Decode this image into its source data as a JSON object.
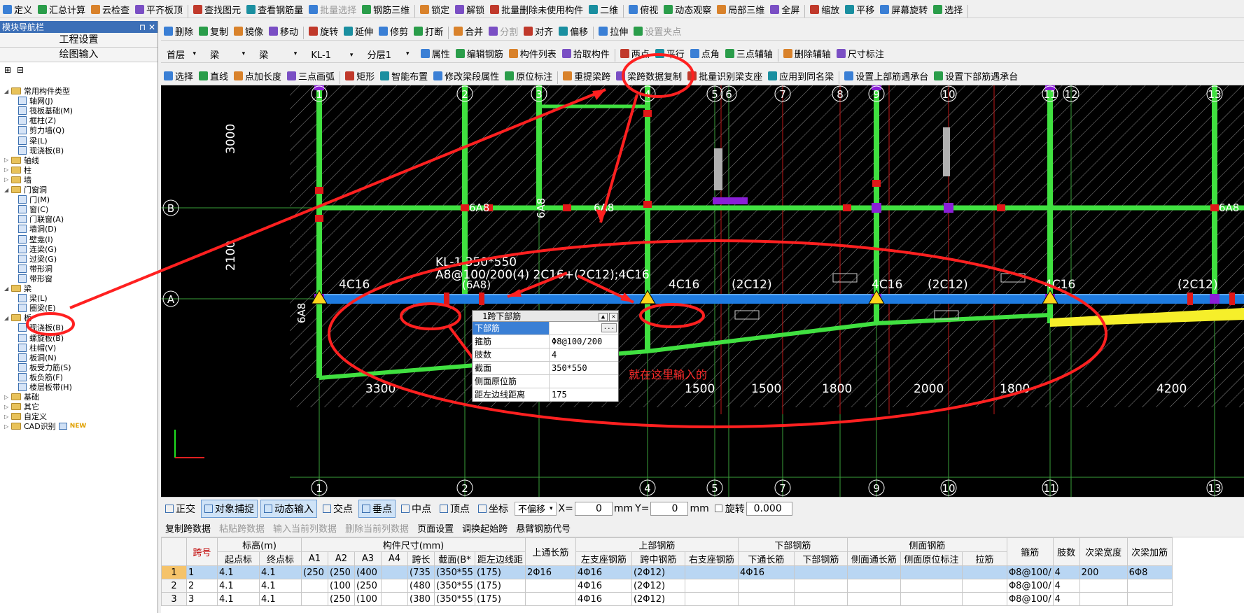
{
  "toolbar1": {
    "items": [
      "定义",
      "汇总计算",
      "云检查",
      "平齐板顶",
      "查找图元",
      "查看钢筋量",
      "批量选择",
      "钢筋三维",
      "锁定",
      "解锁",
      "批量删除未使用构件",
      "二维",
      "俯视",
      "动态观察",
      "局部三维",
      "全屏",
      "缩放",
      "平移",
      "屏幕旋转",
      "选择"
    ]
  },
  "toolbar2": {
    "items": [
      "删除",
      "复制",
      "镜像",
      "移动",
      "旋转",
      "延伸",
      "修剪",
      "打断",
      "合并",
      "分割",
      "对齐",
      "偏移",
      "拉伸",
      "设置夹点"
    ]
  },
  "toolbar3": {
    "floor": "首层",
    "type1": "梁",
    "type2": "梁",
    "element": "KL-1",
    "layer": "分层1",
    "items": [
      "属性",
      "编辑钢筋",
      "构件列表",
      "拾取构件",
      "两点",
      "平行",
      "点角",
      "三点辅轴",
      "删除辅轴",
      "尺寸标注"
    ]
  },
  "toolbar4": {
    "items": [
      "选择",
      "直线",
      "点加长度",
      "三点画弧",
      "矩形",
      "智能布置",
      "修改梁段属性",
      "原位标注",
      "重提梁跨",
      "梁跨数据复制",
      "批量识别梁支座",
      "应用到同名梁",
      "设置上部筋遇承台",
      "设置下部筋遇承台"
    ]
  },
  "panel": {
    "title": "模块导航栏",
    "btn1": "工程设置",
    "btn2": "绘图输入",
    "tree": [
      {
        "label": "常用构件类型",
        "level": 0,
        "folder": true,
        "open": true
      },
      {
        "label": "轴网(J)",
        "level": 1
      },
      {
        "label": "筏板基础(M)",
        "level": 1
      },
      {
        "label": "框柱(Z)",
        "level": 1
      },
      {
        "label": "剪力墙(Q)",
        "level": 1
      },
      {
        "label": "梁(L)",
        "level": 1
      },
      {
        "label": "现浇板(B)",
        "level": 1
      },
      {
        "label": "轴线",
        "level": 0,
        "folder": true
      },
      {
        "label": "柱",
        "level": 0,
        "folder": true
      },
      {
        "label": "墙",
        "level": 0,
        "folder": true
      },
      {
        "label": "门窗洞",
        "level": 0,
        "folder": true,
        "open": true
      },
      {
        "label": "门(M)",
        "level": 1
      },
      {
        "label": "窗(C)",
        "level": 1
      },
      {
        "label": "门联窗(A)",
        "level": 1
      },
      {
        "label": "墙洞(D)",
        "level": 1
      },
      {
        "label": "壁龛(I)",
        "level": 1
      },
      {
        "label": "连梁(G)",
        "level": 1
      },
      {
        "label": "过梁(G)",
        "level": 1
      },
      {
        "label": "带形洞",
        "level": 1
      },
      {
        "label": "带形窗",
        "level": 1
      },
      {
        "label": "梁",
        "level": 0,
        "folder": true,
        "open": true
      },
      {
        "label": "梁(L)",
        "level": 1
      },
      {
        "label": "圈梁(E)",
        "level": 1
      },
      {
        "label": "板",
        "level": 0,
        "folder": true,
        "open": true
      },
      {
        "label": "现浇板(B)",
        "level": 1
      },
      {
        "label": "螺旋板(B)",
        "level": 1
      },
      {
        "label": "柱帽(V)",
        "level": 1
      },
      {
        "label": "板洞(N)",
        "level": 1
      },
      {
        "label": "板受力筋(S)",
        "level": 1
      },
      {
        "label": "板负筋(F)",
        "level": 1
      },
      {
        "label": "楼层板带(H)",
        "level": 1
      },
      {
        "label": "基础",
        "level": 0,
        "folder": true
      },
      {
        "label": "其它",
        "level": 0,
        "folder": true
      },
      {
        "label": "自定义",
        "level": 0,
        "folder": true
      },
      {
        "label": "CAD识别",
        "level": 0,
        "folder": true,
        "badge": "NEW"
      }
    ]
  },
  "canvas": {
    "axis_top": [
      "1",
      "2",
      "3",
      "4",
      "5",
      "6",
      "7",
      "8",
      "9",
      "10",
      "11",
      "12",
      "13"
    ],
    "axis_bottom": [
      "1",
      "2",
      "4",
      "5",
      "7",
      "9",
      "10",
      "11",
      "13"
    ],
    "axis_left": [
      "B",
      "A"
    ],
    "dims_vertical": [
      "3000",
      "2100"
    ],
    "dims_bottom": [
      "3300",
      "1500",
      "1500",
      "1800",
      "2000",
      "1800",
      "4200"
    ],
    "labels": {
      "beam_name": "KL-1 350*550",
      "beam_spec": "A8@100/200(4) 2C16+(2C12);4C16",
      "a": "(6A8)",
      "b": "4C16",
      "c": "(2C12)",
      "d": "6A8",
      "note": "就在这里输入的"
    },
    "colors": {
      "beam": "#1e7be0",
      "column": "#40e040",
      "annot": "#ff2020",
      "grid": "#ffffff"
    }
  },
  "popup": {
    "title": "1跨下部筋",
    "rows": [
      {
        "k": "下部筋",
        "v": ""
      },
      {
        "k": "箍筋",
        "v": "Φ8@100/200"
      },
      {
        "k": "肢数",
        "v": "4"
      },
      {
        "k": "截面",
        "v": "350*550"
      },
      {
        "k": "侧面原位筋",
        "v": ""
      },
      {
        "k": "距左边线距离",
        "v": "175"
      }
    ]
  },
  "status": {
    "items": [
      "正交",
      "对象捕捉",
      "动态输入",
      "交点",
      "垂点",
      "中点",
      "顶点",
      "坐标"
    ],
    "offset": "不偏移",
    "x_label": "X=",
    "x": "0",
    "mm1": "mm",
    "y_label": "Y=",
    "y": "0",
    "mm2": "mm",
    "rotate_label": "旋转",
    "rotate": "0.000"
  },
  "grid_toolbar": {
    "items": [
      "复制跨数据",
      "粘贴跨数据",
      "输入当前列数据",
      "删除当前列数据",
      "页面设置",
      "调换起始跨",
      "悬臂钢筋代号"
    ]
  },
  "table": {
    "groups": [
      "标高(m)",
      "构件尺寸(mm)",
      "上部钢筋",
      "下部钢筋",
      "侧面钢筋"
    ],
    "headers": [
      "跨号",
      "起点标",
      "终点标",
      "A1",
      "A2",
      "A3",
      "A4",
      "跨长",
      "截面(B*",
      "距左边线距",
      "上通长筋",
      "左支座钢筋",
      "跨中钢筋",
      "右支座钢筋",
      "下通长筋",
      "下部钢筋",
      "侧面通长筋",
      "侧面原位标注",
      "拉筋",
      "箍筋",
      "肢数",
      "次梁宽度",
      "次梁加筋"
    ],
    "single_headers": [
      "上通长筋",
      "箍筋",
      "肢数",
      "次梁宽度",
      "次梁加筋"
    ],
    "rows": [
      [
        "1",
        "1",
        "4.1",
        "4.1",
        "(250",
        "(250",
        "(400",
        "",
        "(735",
        "(350*55",
        "(175)",
        "2Φ16",
        "4Φ16",
        "(2Φ12)",
        "",
        "4Φ16",
        "",
        "",
        "",
        "",
        "Φ8@100/",
        "4",
        "200",
        "6Φ8"
      ],
      [
        "2",
        "2",
        "4.1",
        "4.1",
        "",
        "(100",
        "(250",
        "",
        "(480",
        "(350*55",
        "(175)",
        "",
        "4Φ16",
        "(2Φ12)",
        "",
        "",
        "",
        "",
        "",
        "",
        "Φ8@100/",
        "4",
        "",
        ""
      ],
      [
        "3",
        "3",
        "4.1",
        "4.1",
        "",
        "(250",
        "(100",
        "",
        "(380",
        "(350*55",
        "(175)",
        "",
        "4Φ16",
        "(2Φ12)",
        "",
        "",
        "",
        "",
        "",
        "",
        "Φ8@100/",
        "4",
        "",
        ""
      ]
    ]
  }
}
